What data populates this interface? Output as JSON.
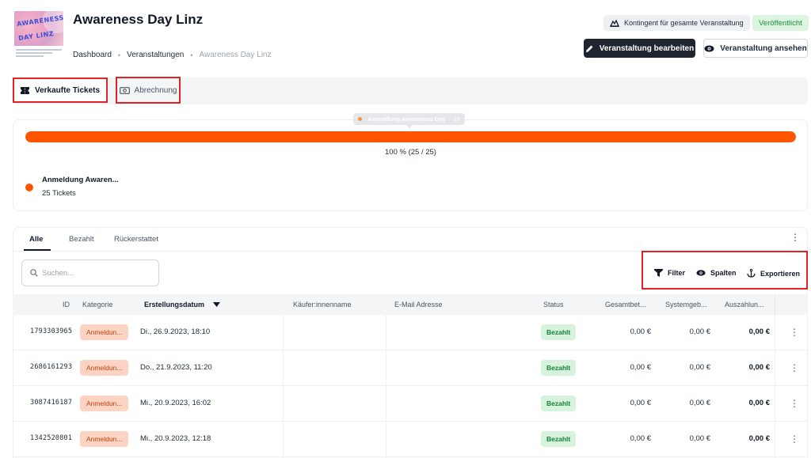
{
  "header": {
    "title": "Awareness Day Linz",
    "logo": {
      "word1": "AWARENESS",
      "word2": "DAY LINZ"
    },
    "breadcrumb": [
      "Dashboard",
      "Veranstaltungen",
      "Awareness Day Linz"
    ],
    "kontingent_label": "Kontingent für gesamte Veranstaltung",
    "status_badge": "Veröffentlicht",
    "edit_label": "Veranstaltung bearbeiten",
    "view_label": "Veranstaltung ansehen"
  },
  "tabs": {
    "sold": "Verkaufte Tickets",
    "billing": "Abrechnung"
  },
  "progress": {
    "tooltip_name": "Anmeldung Awareness Day",
    "tooltip_count": "25",
    "fraction": 1.0,
    "text": "100 % (25 / 25)",
    "legend_name": "Anmeldung Awaren...",
    "legend_count": "25 Tickets",
    "color": "#ff5400"
  },
  "filters": {
    "tabs": [
      "Alle",
      "Bezahlt",
      "Rückerstattet"
    ],
    "active": "Alle"
  },
  "search": {
    "placeholder": "Suchen...",
    "value": ""
  },
  "toolbar": {
    "filter": "Filter",
    "columns": "Spalten",
    "export": "Exportieren"
  },
  "table": {
    "columns": [
      "ID",
      "Kategorie",
      "Erstellungsdatum",
      "Käufer:innenname",
      "E-Mail Adresse",
      "Status",
      "Gesamtbet...",
      "Systemgeb...",
      "Auszahlun..."
    ],
    "sorted_column": "Erstellungsdatum",
    "rows": [
      {
        "id": "1793303965",
        "category": "Anmeldun...",
        "date": "Di., 26.9.2023, 18:10",
        "buyer": "",
        "email": "",
        "status": "Bezahlt",
        "total": "0,00 €",
        "system_fee": "0,00 €",
        "payout": "0,00 €"
      },
      {
        "id": "2686161293",
        "category": "Anmeldun...",
        "date": "Do., 21.9.2023, 11:20",
        "buyer": "",
        "email": "",
        "status": "Bezahlt",
        "total": "0,00 €",
        "system_fee": "0,00 €",
        "payout": "0,00 €"
      },
      {
        "id": "3087416187",
        "category": "Anmeldun...",
        "date": "Mi., 20.9.2023, 16:02",
        "buyer": "",
        "email": "",
        "status": "Bezahlt",
        "total": "0,00 €",
        "system_fee": "0,00 €",
        "payout": "0,00 €"
      },
      {
        "id": "1342520801",
        "category": "Anmeldun...",
        "date": "Mi., 20.9.2023, 12:18",
        "buyer": "",
        "email": "",
        "status": "Bezahlt",
        "total": "0,00 €",
        "system_fee": "0,00 €",
        "payout": "0,00 €"
      }
    ]
  },
  "icons": {
    "kontingent": "crowd-icon",
    "edit": "pencil-icon",
    "view": "eye-icon",
    "sold": "ticket-icon",
    "billing": "cash-icon",
    "search": "search-icon",
    "filter": "funnel-icon",
    "columns": "eye-icon",
    "export": "anchor-icon",
    "more": "kebab-icon"
  },
  "colors": {
    "accent": "#ff5400",
    "dark_button": "#1f2530",
    "published_bg": "#dcf5e1",
    "published_text": "#1f8a3b",
    "highlight_box": "#e02424"
  }
}
